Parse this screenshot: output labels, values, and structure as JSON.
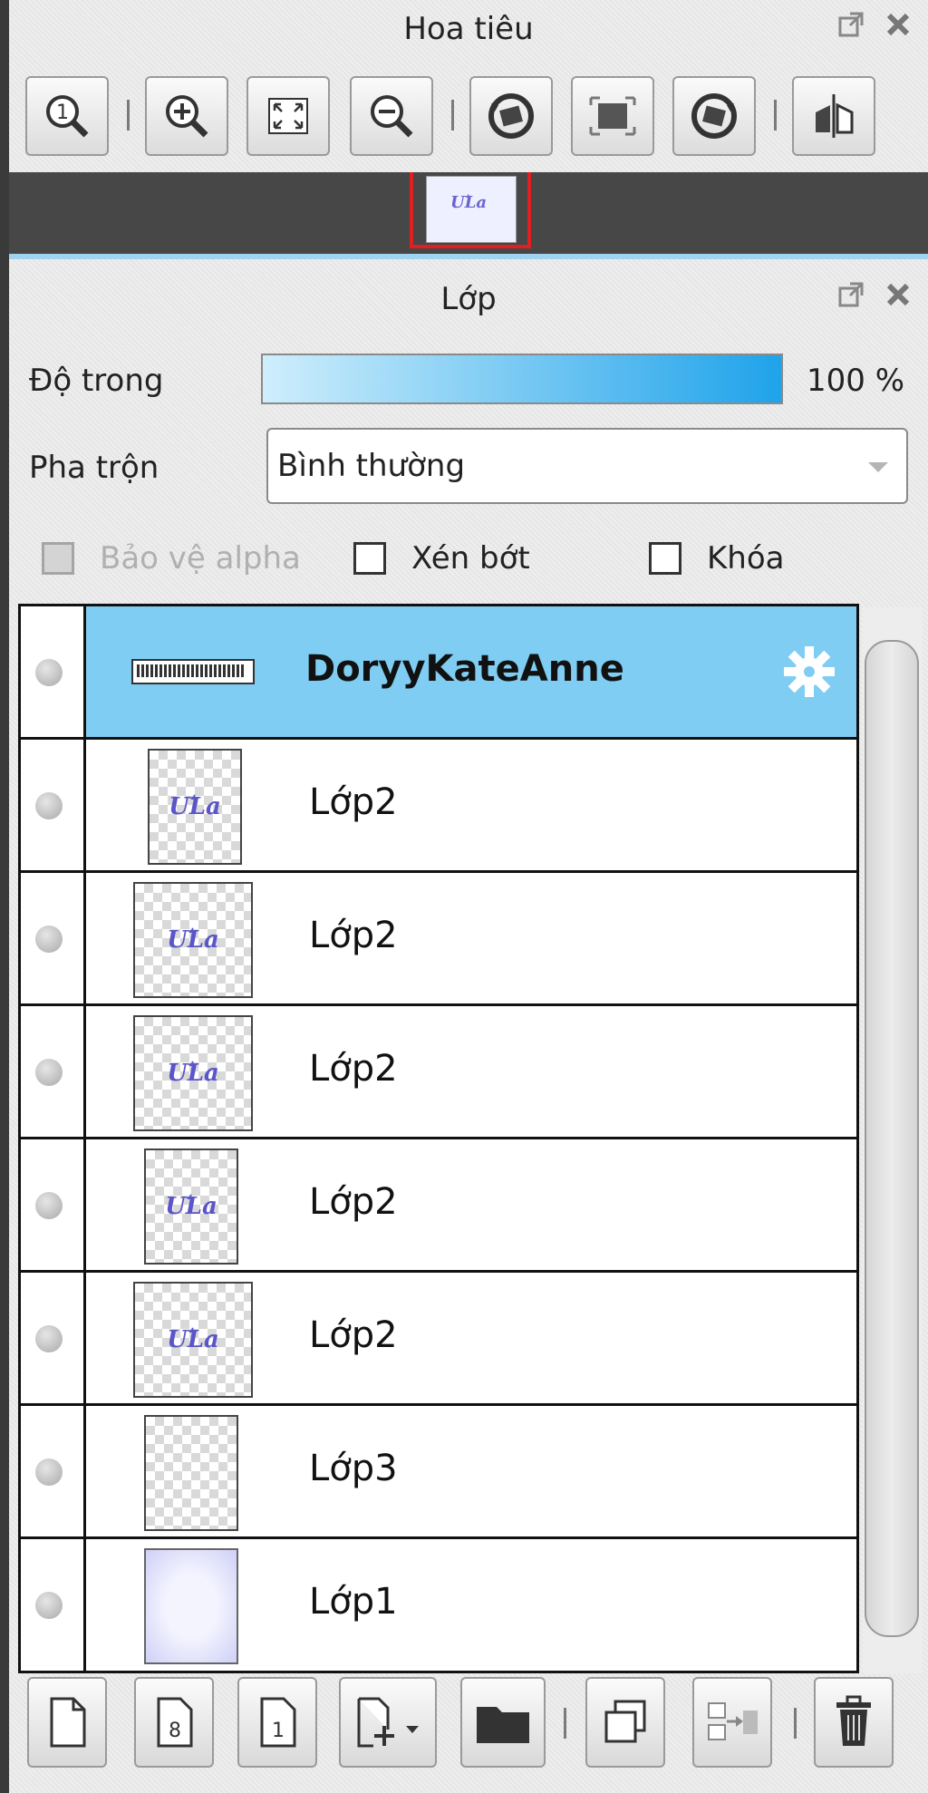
{
  "navigator": {
    "title": "Hoa tiêu",
    "toolbar": [
      "zoom-reset-icon",
      "zoom-in-icon",
      "fit-window-icon",
      "zoom-out-icon",
      "rotate-left-icon",
      "reset-view-icon",
      "rotate-right-icon",
      "flip-horizontal-icon"
    ]
  },
  "layers_panel": {
    "title": "Lớp",
    "opacity_label": "Độ trong",
    "opacity_value": "100 %",
    "opacity_fraction": 1.0,
    "blend_label": "Pha trộn",
    "blend_value": "Bình thường",
    "protect_alpha_label": "Bảo vệ alpha",
    "clipping_label": "Xén bớt",
    "lock_label": "Khóa",
    "layers": [
      {
        "name": "DoryyKateAnne",
        "selected": true
      },
      {
        "name": "Lớp2"
      },
      {
        "name": "Lớp2"
      },
      {
        "name": "Lớp2"
      },
      {
        "name": "Lớp2"
      },
      {
        "name": "Lớp2"
      },
      {
        "name": "Lớp3"
      },
      {
        "name": "Lớp1"
      }
    ],
    "thumb_mark": "ƯLa"
  },
  "colors": {
    "selected_row": "#7fcdf2",
    "opacity_bar_start": "#cfeefc",
    "opacity_bar_end": "#1fa3ea",
    "navigator_frame": "#e02020"
  }
}
